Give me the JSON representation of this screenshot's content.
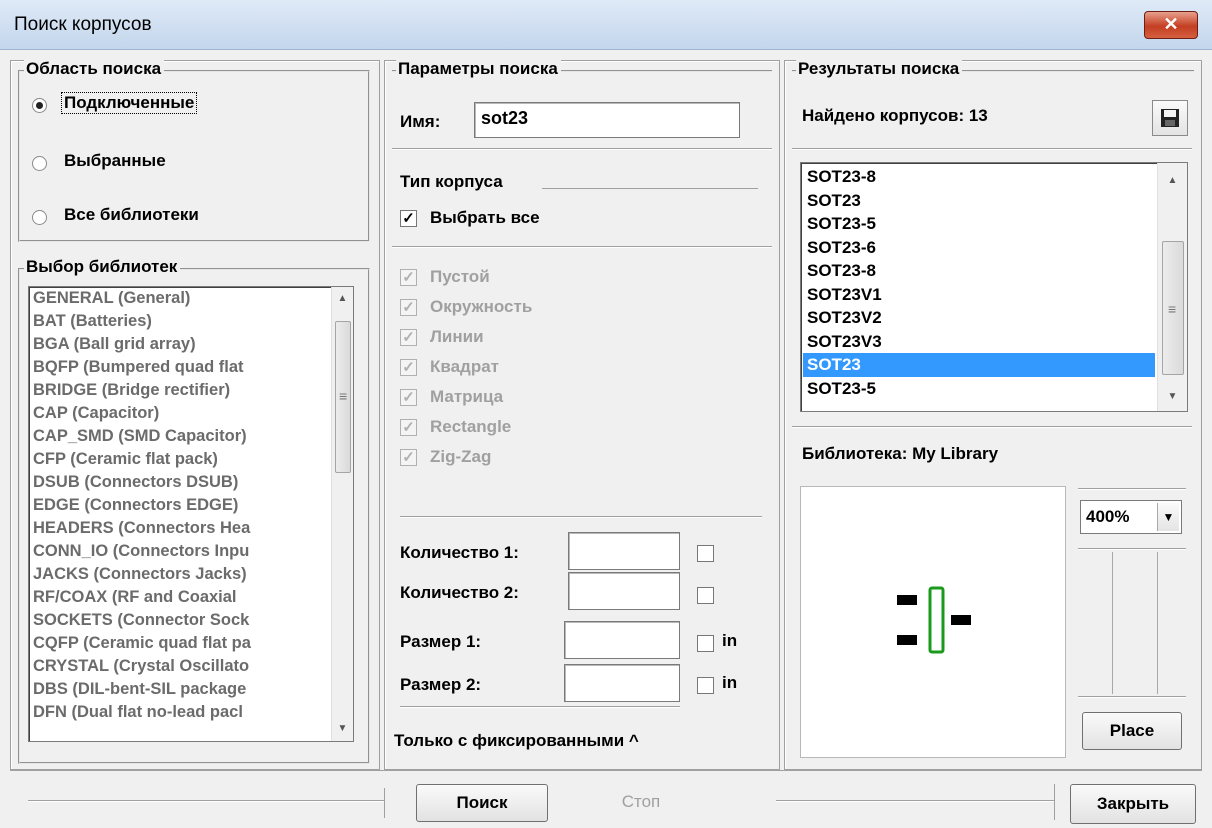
{
  "window": {
    "title": "Поиск корпусов",
    "close_glyph": "✕"
  },
  "search_area": {
    "title": "Область поиска",
    "options": [
      {
        "label": "Подключенные",
        "selected": true
      },
      {
        "label": "Выбранные",
        "selected": false
      },
      {
        "label": "Все библиотеки",
        "selected": false
      }
    ]
  },
  "library_select": {
    "title": "Выбор библиотек",
    "items": [
      "GENERAL (General)",
      "BAT (Batteries)",
      "BGA (Ball grid array)",
      "BQFP (Bumpered quad flat",
      "BRIDGE (Bridge rectifier)",
      "CAP (Capacitor)",
      "CAP_SMD (SMD Capacitor)",
      "CFP (Ceramic flat pack)",
      "DSUB (Connectors DSUB)",
      "EDGE (Connectors EDGE)",
      "HEADERS (Connectors Hea",
      "CONN_IO (Connectors Inpu",
      "JACKS (Connectors Jacks)",
      "RF/COAX (RF and Coaxial",
      "SOCKETS (Connector Sock",
      "CQFP (Ceramic quad flat pa",
      "CRYSTAL (Crystal Oscillato",
      "DBS (DIL-bent-SIL package",
      "DFN (Dual flat no-lead pacl"
    ]
  },
  "search_params": {
    "title": "Параметры поиска",
    "name_label": "Имя:",
    "name_value": "sot23",
    "package_type_title": "Тип корпуса",
    "select_all_label": "Выбрать все",
    "select_all_checked": true,
    "types": [
      "Пустой",
      "Окружность",
      "Линии",
      "Квадрат",
      "Матрица",
      "Rectangle",
      "Zig-Zag"
    ],
    "qty1_label": "Количество 1:",
    "qty2_label": "Количество 2:",
    "size1_label": "Размер 1:",
    "size2_label": "Размер 2:",
    "unit_in": "in",
    "fixed_only_label": "Только с фиксированными ^"
  },
  "results": {
    "title": "Результаты поиска",
    "found_label": "Найдено корпусов: 13",
    "items": [
      "SOT23-8",
      "SOT23",
      "SOT23-5",
      "SOT23-6",
      "SOT23-8",
      "SOT23V1",
      "SOT23V2",
      "SOT23V3",
      "SOT23",
      "SOT23-5"
    ],
    "selected_index": 8,
    "library_label": "Библиотека: My Library",
    "zoom": "400%",
    "place_label": "Place"
  },
  "footer": {
    "search_label": "Поиск",
    "stop_label": "Стоп",
    "close_label": "Закрыть"
  },
  "colors": {
    "selection": "#3399ff",
    "preview_outline": "#1a9a1a"
  }
}
